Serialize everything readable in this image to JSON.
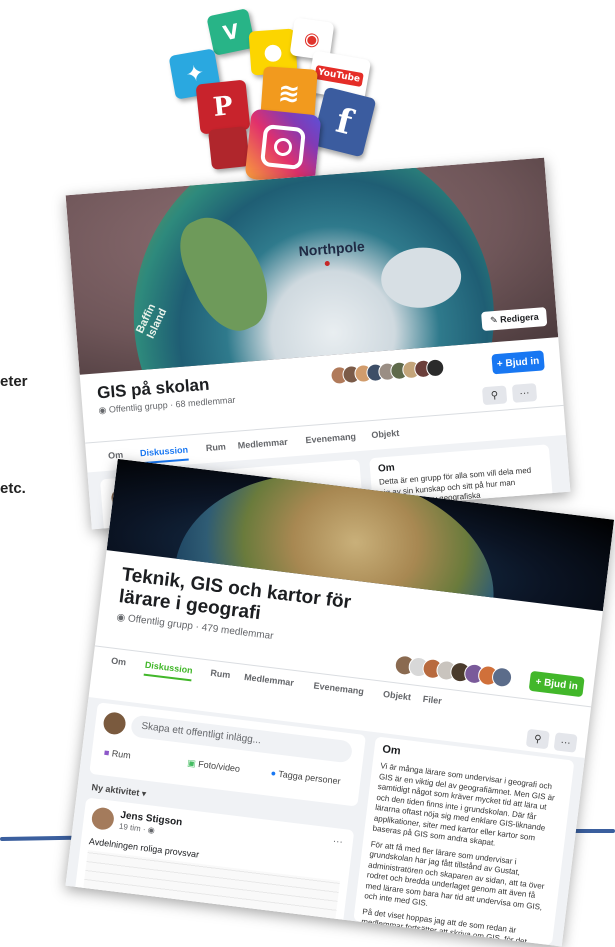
{
  "slide": {
    "frag1": "eter",
    "frag2": "etc.",
    "accent_color": "#3b5f9e"
  },
  "social_icons": [
    "vine-icon",
    "snapchat-icon",
    "periscope-icon",
    "twitter-icon",
    "youtube-icon",
    "pinterest-icon",
    "rss-icon",
    "facebook-icon",
    "instagram-icon"
  ],
  "youtube_label": "YouTube",
  "cover1": {
    "northpole_label": "Northpole",
    "island_label": "Baffin\nIsland",
    "edit_button": "Redigera"
  },
  "group1": {
    "name": "GIS på skolan",
    "meta": "Offentlig grupp · 68 medlemmar",
    "invite_button": "+ Bjud in",
    "search_icon": "search-icon",
    "more_button": "···",
    "tabs": [
      "Om",
      "Diskussion",
      "Rum",
      "Medlemmar",
      "Evenemang",
      "Objekt"
    ],
    "about_heading": "Om",
    "about_snippet": "Detta är en grupp för alla som vill dela med sig av sin kunskap och sitt på hur man använder sig av geografiska informationssystem (GIS) i skola..."
  },
  "group2": {
    "name": "Teknik, GIS och kartor för lärare i geografi",
    "meta": "Offentlig grupp · 479 medlemmar",
    "invite_button": "+ Bjud in",
    "more_button": "···",
    "tabs": [
      "Om",
      "Diskussion",
      "Rum",
      "Medlemmar",
      "Evenemang",
      "Objekt",
      "Filer"
    ],
    "composer_placeholder": "Skapa ett offentligt inlägg...",
    "actions": [
      "Rum",
      "Foto/video",
      "Tagga personer"
    ],
    "activity_label": "Ny aktivitet",
    "post": {
      "author": "Jens Stigson",
      "time": "19 tim · ",
      "text": "Avdelningen roliga provsvar",
      "more": "···"
    },
    "about_heading": "Om",
    "about_paragraphs": [
      "Vi är många lärare som undervisar i geografi och GIS är en viktig del av geografiämnet. Men GIS är samtidigt något som kräver mycket tid att lära ut och den tiden finns inte i grundskolan. Där får lärarna oftast nöja sig med enklare GIS-liknande applikationer, siter med kartor eller kartor som baseras på GIS som andra skapat.",
      "För att få med fler lärare som undervisar i grundskolan har jag fått tillstånd av Gustat, administratören och skaparen av sidan, att ta över rodret och bredda underlaget genom att även få med lärare som bara har tid att undervisa om GIS, och inte med GIS.",
      "På det viset hoppas jag att de som redan är medlemmar fortsätter att skriva om GIS, för det behövs. Men samtidigt vill jag göra sidan mer användarvänlig för lärare i de yngre åldrarna eller till och med för de som..."
    ]
  }
}
